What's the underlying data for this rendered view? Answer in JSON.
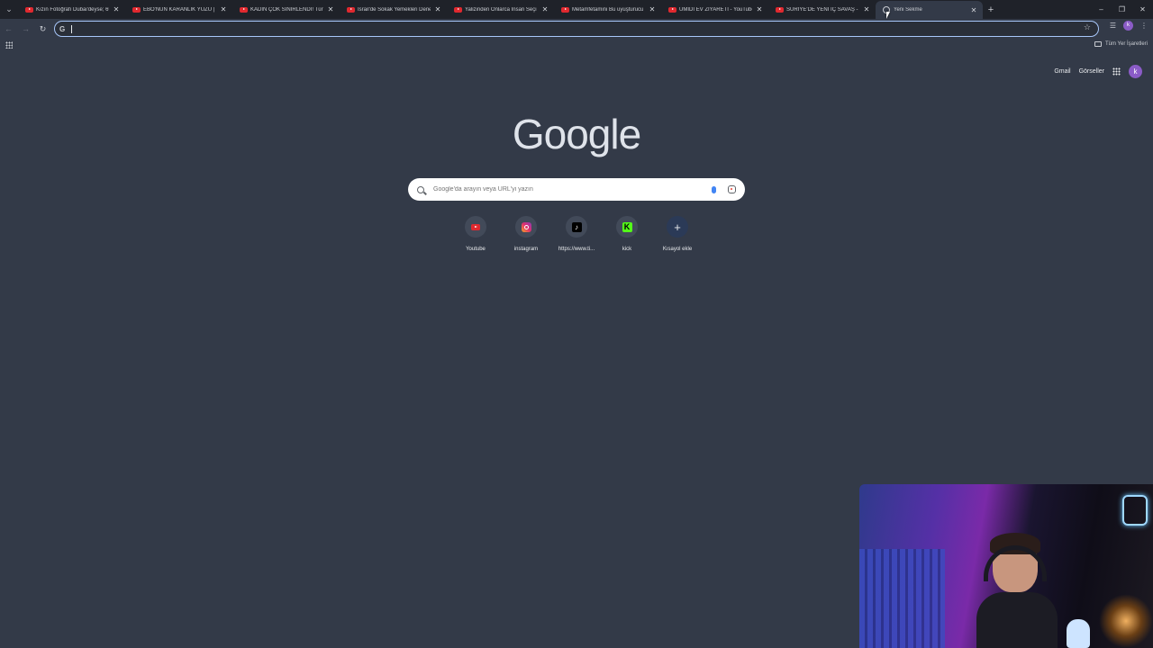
{
  "tabs": [
    {
      "title": "Kızın Fotoğrafı Dubai'deyse; 69",
      "active": false
    },
    {
      "title": "EBO'NUN KARANLIK YÜZÜ | Te",
      "active": false
    },
    {
      "title": "KADIN ÇOK SİNİRLENDİ! Türkiy",
      "active": false
    },
    {
      "title": "İsrail'de Sokak Yemekleri Dene",
      "active": false
    },
    {
      "title": "Yalizinden Onlarca İnsan Seçi (",
      "active": false
    },
    {
      "title": "Metamfetamini Bu uyuşturucu",
      "active": false
    },
    {
      "title": "ÜMİDİ EV ZİYARETİ - YouTube",
      "active": false
    },
    {
      "title": "SURİYE'DE YENİ İÇ SAVAŞ - Yo",
      "active": false
    },
    {
      "title": "Yeni Sekme",
      "active": true
    }
  ],
  "omnibox": {
    "value": "",
    "icon": "google-g-icon"
  },
  "bookmarks": {
    "all_label": "Tüm Yer İşaretleri"
  },
  "google": {
    "gmail": "Gmail",
    "images": "Görseller",
    "avatar_letter": "k",
    "logo": "Google",
    "search_placeholder": "Google'da arayın veya URL'yi yazın"
  },
  "shortcuts": [
    {
      "label": "Youtube",
      "icon": "youtube-icon"
    },
    {
      "label": "instagram",
      "icon": "instagram-icon"
    },
    {
      "label": "https://www.ti...",
      "icon": "tiktok-icon"
    },
    {
      "label": "kick",
      "icon": "kick-icon"
    },
    {
      "label": "Kısayol ekle",
      "icon": "plus-icon"
    }
  ],
  "colors": {
    "background": "#333a48",
    "tabstrip": "#1f2229",
    "omnibox_focus": "#a8c7fa",
    "avatar": "#8b5cc7"
  }
}
